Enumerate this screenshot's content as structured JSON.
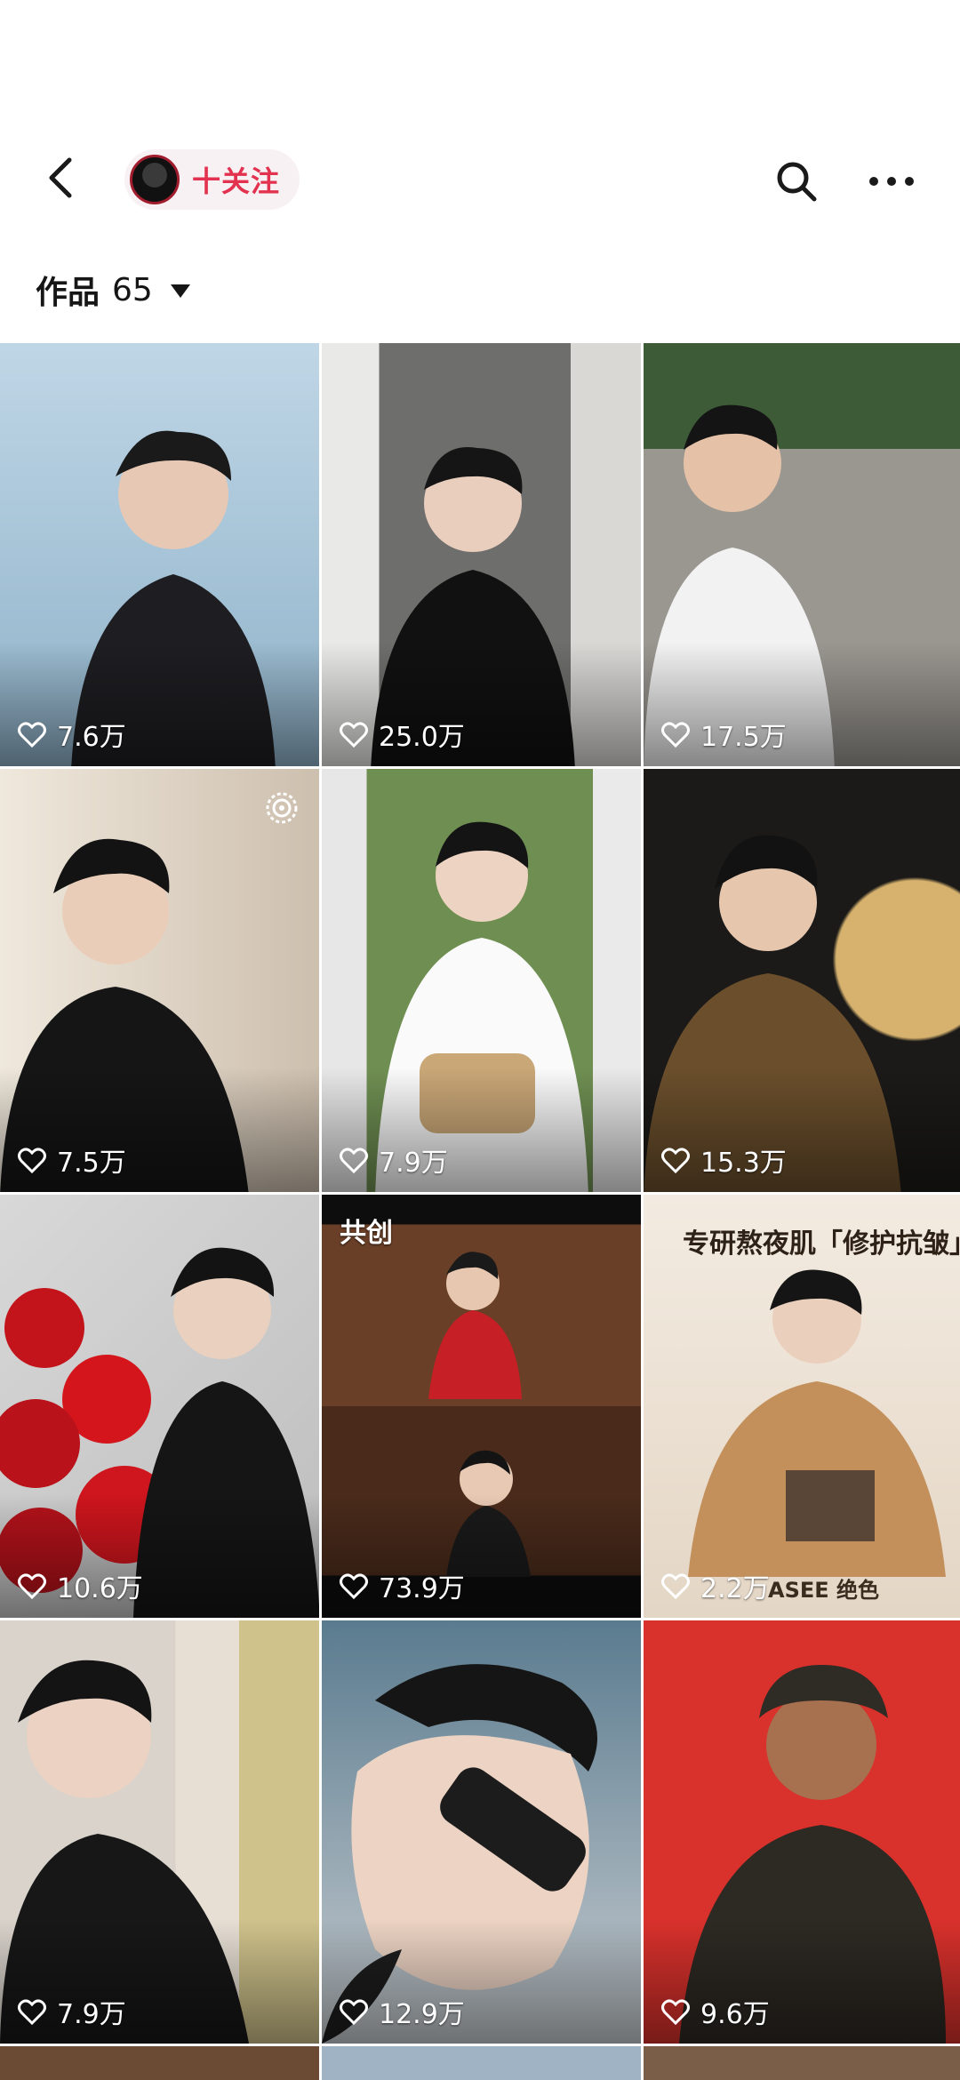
{
  "header": {
    "follow_label": "十关注"
  },
  "tabs": {
    "works_label": "作品",
    "works_count": "65"
  },
  "grid": [
    {
      "likes": "7.6万"
    },
    {
      "likes": "25.0万"
    },
    {
      "likes": "17.5万"
    },
    {
      "likes": "7.5万"
    },
    {
      "likes": "7.9万"
    },
    {
      "likes": "15.3万"
    },
    {
      "likes": "10.6万"
    },
    {
      "likes": "73.9万",
      "badge": "共创"
    },
    {
      "likes": "2.2万",
      "ad_title": "专研熬夜肌「修护抗皱」",
      "ad_brand": "ASEE 绝色"
    },
    {
      "likes": "7.9万"
    },
    {
      "likes": "12.9万"
    },
    {
      "likes": "9.6万"
    }
  ],
  "colors": {
    "accent": "#e3324f",
    "text": "#161616"
  },
  "icons": [
    "back-arrow-icon",
    "search-icon",
    "more-icon",
    "heart-icon",
    "live-icon"
  ]
}
